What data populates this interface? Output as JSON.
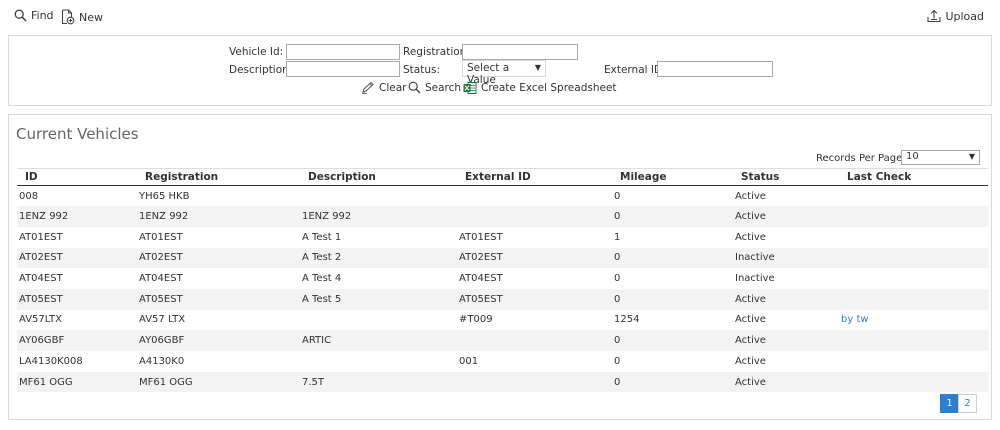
{
  "toolbar": {
    "find_label": "Find",
    "new_label": "New",
    "upload_label": "Upload"
  },
  "search": {
    "vehicle_id_label": "Vehicle Id:",
    "registration_label": "Registration:",
    "description_label": "Description:",
    "status_label": "Status:",
    "status_value": "Select a Value",
    "external_id_label": "External ID:",
    "vehicle_id_value": "",
    "registration_value": "",
    "description_value": "",
    "external_id_value": "",
    "clear_label": "Clear",
    "search_label": "Search",
    "excel_label": "Create Excel Spreadsheet"
  },
  "results": {
    "title": "Current Vehicles",
    "records_per_page_label": "Records Per Page:",
    "records_per_page_value": "10",
    "columns": [
      "ID",
      "Registration",
      "Description",
      "External ID",
      "Mileage",
      "Status",
      "Last Check"
    ],
    "rows": [
      [
        "008",
        "YH65 HKB",
        "",
        "",
        "0",
        "Active",
        ""
      ],
      [
        "1ENZ 992",
        "1ENZ 992",
        "1ENZ 992",
        "",
        "0",
        "Active",
        ""
      ],
      [
        "AT01EST",
        "AT01EST",
        "A Test 1",
        "AT01EST",
        "1",
        "Active",
        ""
      ],
      [
        "AT02EST",
        "AT02EST",
        "A Test 2",
        "AT02EST",
        "0",
        "Inactive",
        ""
      ],
      [
        "AT04EST",
        "AT04EST",
        "A Test 4",
        "AT04EST",
        "0",
        "Inactive",
        ""
      ],
      [
        "AT05EST",
        "AT05EST",
        "A Test 5",
        "AT05EST",
        "0",
        "Active",
        ""
      ],
      [
        "AV57LTX",
        "AV57 LTX",
        "",
        "#T009",
        "1254",
        "Active",
        "by tw"
      ],
      [
        "AY06GBF",
        "AY06GBF",
        "ARTIC",
        "",
        "0",
        "Active",
        ""
      ],
      [
        "LA4130K008",
        "A4130K0",
        "",
        "001",
        "0",
        "Active",
        ""
      ],
      [
        "MF61 OGG",
        "MF61 OGG",
        "7.5T",
        "",
        "0",
        "Active",
        ""
      ]
    ],
    "pages": [
      "1",
      "2"
    ],
    "current_page": "1"
  },
  "icons": {
    "find": "search-icon",
    "new": "new-document-icon",
    "upload": "upload-icon",
    "clear": "pencil-icon",
    "search": "search-icon",
    "excel": "excel-icon"
  },
  "colors": {
    "link": "#3a7fc6",
    "active_page": "#2f7fd1",
    "excel_green": "#1f7a3c"
  }
}
